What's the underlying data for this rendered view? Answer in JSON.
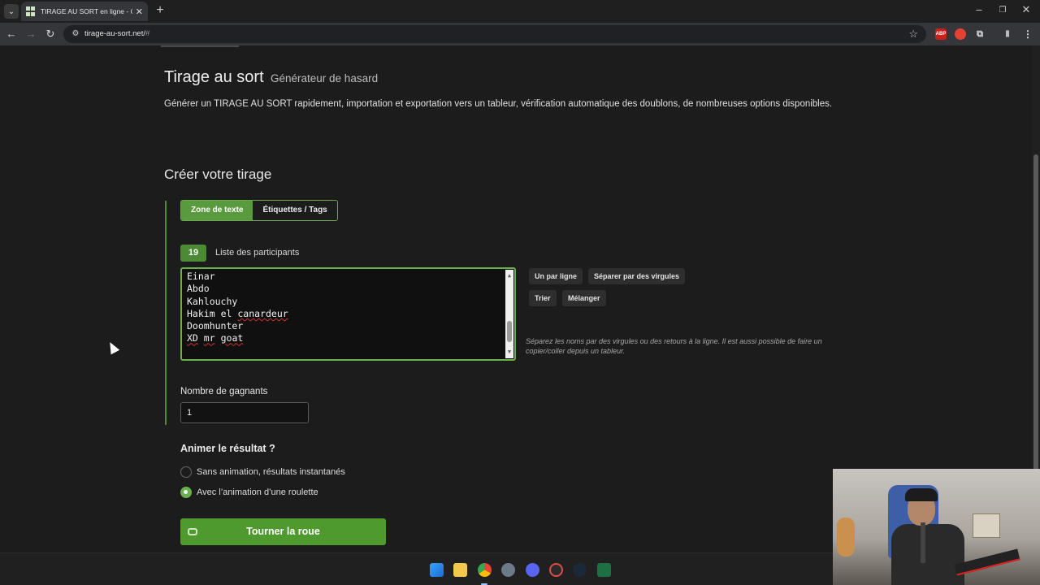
{
  "browser": {
    "tab_title": "TIRAGE AU SORT en ligne - Gén",
    "url_host": "tirage-au-sort.net/",
    "url_rest": "#",
    "extensions": [
      "ABP"
    ]
  },
  "header": {
    "title": "Tirage au sort",
    "subtitle": "Générateur de hasard",
    "intro": "Générer un TIRAGE AU SORT rapidement, importation et exportation vers un tableur, vérification automatique des doublons, de nombreuses options disponibles."
  },
  "create": {
    "heading": "Créer votre tirage",
    "tabs": [
      {
        "label": "Zone de texte",
        "active": true
      },
      {
        "label": "Étiquettes / Tags",
        "active": false
      }
    ],
    "participant_count": "19",
    "participants_label": "Liste des participants",
    "participants": [
      "Einar",
      "Abdo",
      "Kahlouchy",
      "Hakim el canardeur",
      "Doomhunter",
      "XD mr goat"
    ],
    "buttons": {
      "one_per_line": "Un par ligne",
      "split_commas": "Séparer par des virgules",
      "sort": "Trier",
      "shuffle": "Mélanger"
    },
    "hint": "Séparez les noms par des virgules ou des retours à la ligne. Il est aussi possible de faire un copier/coller depuis un tableur.",
    "winners_label": "Nombre de gagnants",
    "winners_value": "1",
    "animate_title": "Animer le résultat ?",
    "options": [
      {
        "label": "Sans animation, résultats instantanés",
        "selected": false
      },
      {
        "label": "Avec l’animation d’une roulette",
        "selected": true
      }
    ],
    "spin_button": "Tourner la roue"
  },
  "colors": {
    "accent_green": "#5a9a3e",
    "button_green": "#4f9a2e",
    "background": "#1c1c1c"
  }
}
